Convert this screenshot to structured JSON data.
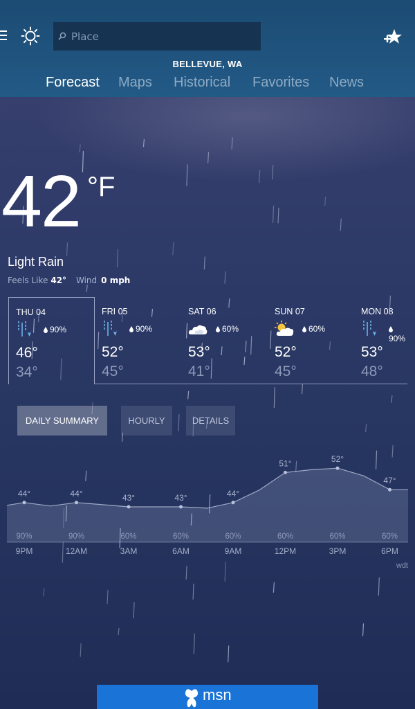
{
  "header": {
    "search_placeholder": "Place",
    "location": "BELLEVUE, WA",
    "tabs": [
      {
        "label": "Forecast",
        "active": true
      },
      {
        "label": "Maps"
      },
      {
        "label": "Historical"
      },
      {
        "label": "Favorites"
      },
      {
        "label": "News"
      }
    ]
  },
  "current": {
    "temperature": "42",
    "unit": "°F",
    "condition": "Light Rain",
    "feels_like_label": "Feels Like",
    "feels_like_value": "42°",
    "wind_label": "Wind",
    "wind_value": "0 mph"
  },
  "daily": [
    {
      "day": "THU 04",
      "icon": "rain-icon",
      "precip": "90%",
      "high": "46°",
      "low": "34°"
    },
    {
      "day": "FRI 05",
      "icon": "rain-icon",
      "precip": "90%",
      "high": "52°",
      "low": "45°"
    },
    {
      "day": "SAT 06",
      "icon": "cloudy-icon",
      "precip": "60%",
      "high": "53°",
      "low": "41°"
    },
    {
      "day": "SUN 07",
      "icon": "partly-sunny-icon",
      "precip": "60%",
      "high": "52°",
      "low": "45°"
    },
    {
      "day": "MON 08",
      "icon": "rain-icon",
      "precip": "90%",
      "high": "53°",
      "low": "48°"
    }
  ],
  "buttons": {
    "daily_summary": "DAILY SUMMARY",
    "hourly": "HOURLY",
    "details": "DETAILS"
  },
  "hourly": {
    "times": [
      "9PM",
      "12AM",
      "3AM",
      "6AM",
      "9AM",
      "12PM",
      "3PM",
      "6PM"
    ],
    "temps": [
      44,
      44,
      43,
      43,
      44,
      51,
      52,
      47
    ],
    "temp_labels": [
      "44°",
      "44°",
      "43°",
      "43°",
      "44°",
      "51°",
      "52°",
      "47°"
    ],
    "precip": [
      "90%",
      "90%",
      "60%",
      "60%",
      "60%",
      "60%",
      "60%",
      "60%"
    ],
    "attribution": "wdt"
  },
  "banner": {
    "text": "msn"
  },
  "colors": {
    "header_bg": "#225a86",
    "accent_blue": "#6bb3ea",
    "banner_blue": "#1a73d6"
  }
}
